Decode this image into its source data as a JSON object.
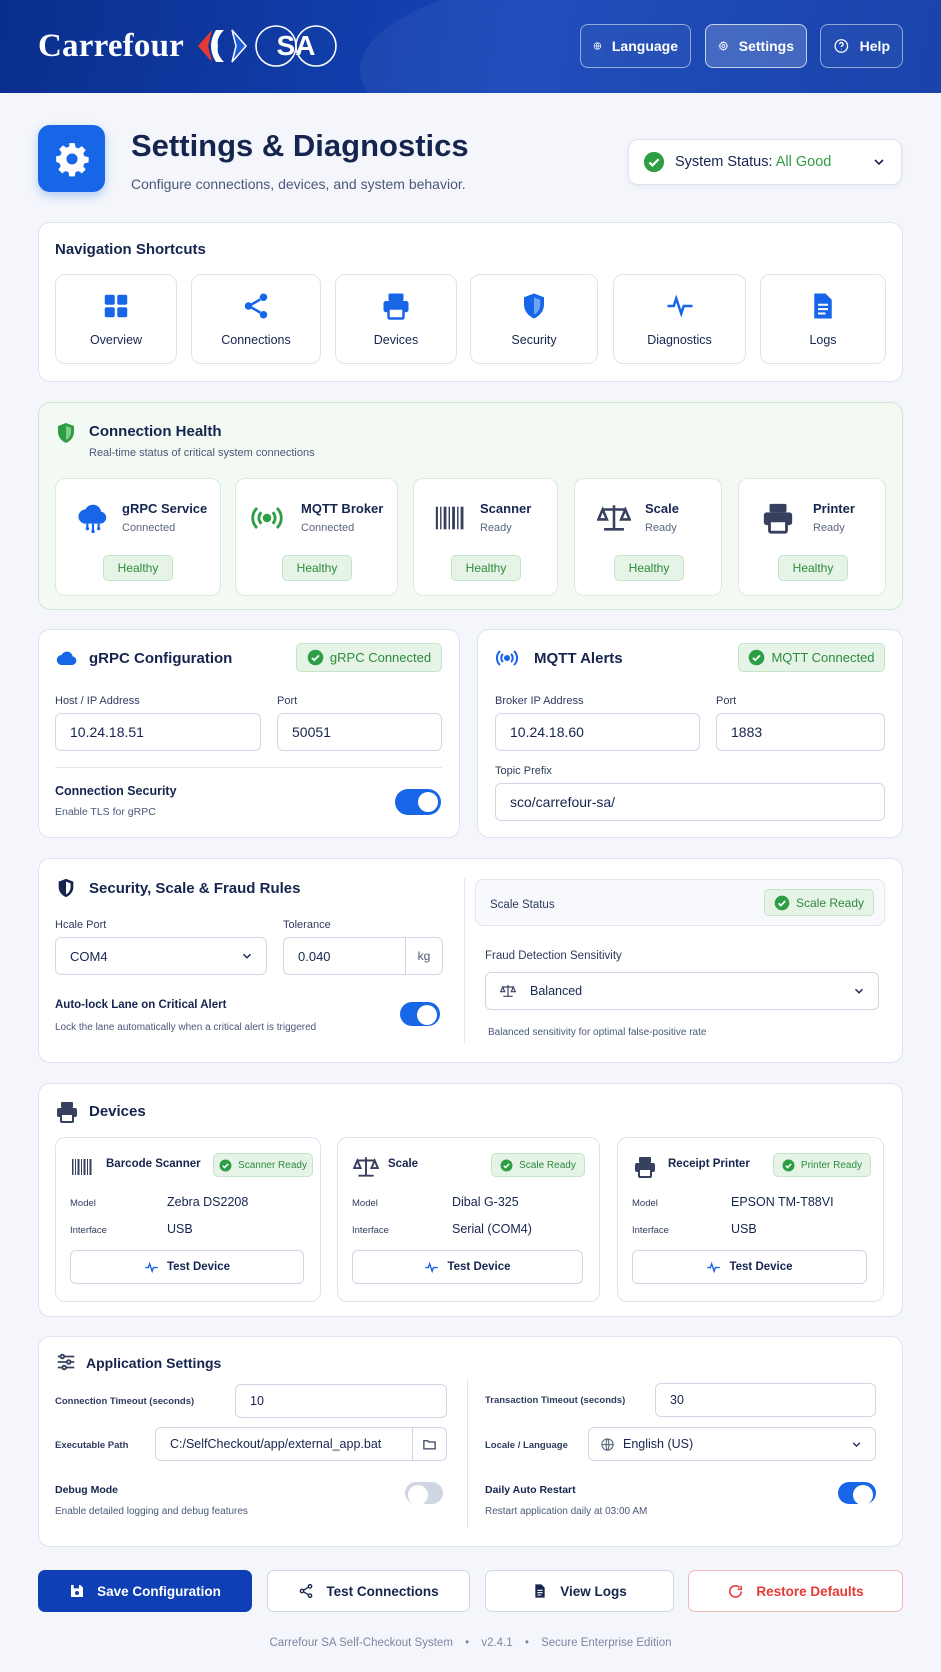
{
  "brand": {
    "word": "Carrefour",
    "suffix": "SA"
  },
  "header": {
    "buttons": [
      {
        "label": "Language",
        "icon": "globe-icon"
      },
      {
        "label": "Settings",
        "icon": "gear-icon",
        "active": true
      },
      {
        "label": "Help",
        "icon": "help-circle-icon"
      }
    ]
  },
  "page": {
    "title": "Settings & Diagnostics",
    "subtitle": "Configure connections, devices, and system behavior.",
    "status_label": "System Status:",
    "status_value": "All Good"
  },
  "shortcuts": {
    "title": "Navigation Shortcuts",
    "items": [
      {
        "label": "Overview",
        "icon": "grid-icon"
      },
      {
        "label": "Connections",
        "icon": "share-icon"
      },
      {
        "label": "Devices",
        "icon": "printer-icon"
      },
      {
        "label": "Security",
        "icon": "shield-icon"
      },
      {
        "label": "Diagnostics",
        "icon": "pulse-icon"
      },
      {
        "label": "Logs",
        "icon": "document-icon"
      }
    ]
  },
  "health": {
    "title": "Connection Health",
    "subtitle": "Real-time status of critical system connections",
    "items": [
      {
        "name": "gRPC Service",
        "state": "Connected",
        "badge": "Healthy",
        "icon": "cloud-icon"
      },
      {
        "name": "MQTT Broker",
        "state": "Connected",
        "badge": "Healthy",
        "icon": "broadcast-icon"
      },
      {
        "name": "Scanner",
        "state": "Ready",
        "badge": "Healthy",
        "icon": "barcode-icon"
      },
      {
        "name": "Scale",
        "state": "Ready",
        "badge": "Healthy",
        "icon": "scale-icon"
      },
      {
        "name": "Printer",
        "state": "Ready",
        "badge": "Healthy",
        "icon": "printer-icon"
      }
    ]
  },
  "grpc": {
    "title": "gRPC Configuration",
    "badge": "gRPC Connected",
    "host_label": "Host / IP Address",
    "host_value": "10.24.18.51",
    "port_label": "Port",
    "port_value": "50051",
    "security_label": "Connection Security",
    "security_desc": "Enable TLS for gRPC",
    "tls_enabled": true
  },
  "mqtt": {
    "title": "MQTT Alerts",
    "badge": "MQTT Connected",
    "broker_label": "Broker IP Address",
    "broker_value": "10.24.18.60",
    "port_label": "Port",
    "port_value": "1883",
    "topic_label": "Topic Prefix",
    "topic_value": "sco/carrefour-sa/"
  },
  "security": {
    "title": "Security, Scale & Fraud Rules",
    "scale_port_label": "Hcale Port",
    "scale_port_value": "COM4",
    "tolerance_label": "Tolerance",
    "tolerance_value": "0.040",
    "tolerance_unit": "kg",
    "autolock_label": "Auto-lock Lane on Critical Alert",
    "autolock_desc": "Lock the lane automatically when a critical alert is triggered",
    "autolock_enabled": true,
    "scale_status_label": "Scale Status",
    "scale_status_badge": "Scale Ready",
    "fraud_label": "Fraud Detection Sensitivity",
    "fraud_value": "Balanced",
    "fraud_desc": "Balanced sensitivity for optimal false-positive rate"
  },
  "devices": {
    "title": "Devices",
    "model_key": "Model",
    "interface_key": "Interface",
    "test_label": "Test Device",
    "items": [
      {
        "name": "Barcode Scanner",
        "badge": "Scanner Ready",
        "model": "Zebra DS2208",
        "interface": "USB",
        "icon": "barcode-icon"
      },
      {
        "name": "Scale",
        "badge": "Scale Ready",
        "model": "Dibal G-325",
        "interface": "Serial (COM4)",
        "icon": "scale-icon"
      },
      {
        "name": "Receipt Printer",
        "badge": "Printer Ready",
        "model": "EPSON TM-T88VI",
        "interface": "USB",
        "icon": "printer-icon"
      }
    ]
  },
  "app": {
    "title": "Application Settings",
    "conn_timeout_label": "Connection Timeout (seconds)",
    "conn_timeout_value": "10",
    "tx_timeout_label": "Transaction Timeout (seconds)",
    "tx_timeout_value": "30",
    "exe_label": "Executable Path",
    "exe_value": "C:/SelfCheckout/app/external_app.bat",
    "locale_label": "Locale / Language",
    "locale_value": "English (US)",
    "debug_label": "Debug Mode",
    "debug_desc": "Enable detailed logging and debug features",
    "debug_enabled": false,
    "restart_label": "Daily Auto Restart",
    "restart_desc": "Restart application daily at 03:00 AM",
    "restart_enabled": true
  },
  "actions": {
    "save": "Save Configuration",
    "test": "Test Connections",
    "logs": "View Logs",
    "restore": "Restore Defaults"
  },
  "footer": {
    "product": "Carrefour SA Self-Checkout System",
    "version": "v2.4.1",
    "edition": "Secure Enterprise Edition",
    "separator": "•"
  },
  "colors": {
    "primary": "#1766e8",
    "navy": "#16254f",
    "header": "#0a2e8c",
    "success": "#2e9e44",
    "danger": "#e53935"
  }
}
